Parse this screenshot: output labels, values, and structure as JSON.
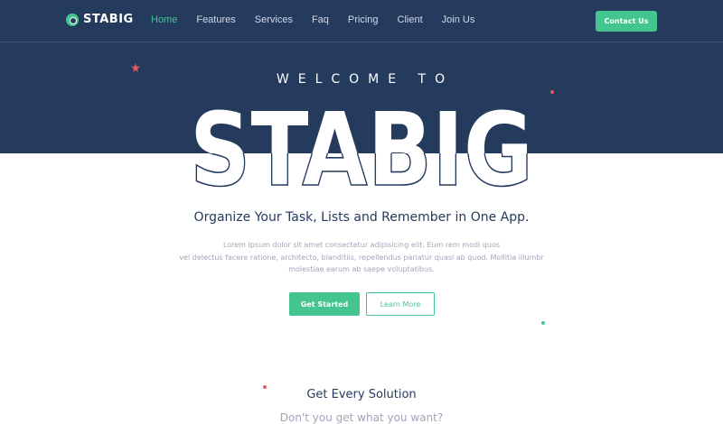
{
  "colors": {
    "hero_bg": "#253b5e",
    "accent": "#44c48f",
    "text_dark": "#253b5e",
    "text_muted": "#a6a3b8",
    "star_red": "#e05a5a"
  },
  "header": {
    "logo_text": "STABIG",
    "logo_icon": "logo-circle-icon",
    "nav": [
      {
        "label": "Home",
        "active": true
      },
      {
        "label": "Features"
      },
      {
        "label": "Services"
      },
      {
        "label": "Faq"
      },
      {
        "label": "Pricing"
      },
      {
        "label": "Client"
      },
      {
        "label": "Join Us"
      }
    ],
    "contact_label": "Contact Us"
  },
  "hero": {
    "welcome": "WELCOME TO",
    "big_title": "STABIG",
    "tagline": "Organize Your Task, Lists and Remember in One App.",
    "description_lines": [
      "Lorem ipsum dolor sit amet consectetur adipisicing elit. Eum rem modi quos",
      "vel delectus facere ratione, architecto, blanditiis, repellendus pariatur quasi ab quod. Mollitia illumbr",
      "molestiae earum ab saepe voluptatibus."
    ],
    "primary_cta": "Get Started",
    "secondary_cta": "Learn More"
  },
  "solutions": {
    "title": "Get Every Solution",
    "subtitle": "Don't you get what you want?"
  }
}
